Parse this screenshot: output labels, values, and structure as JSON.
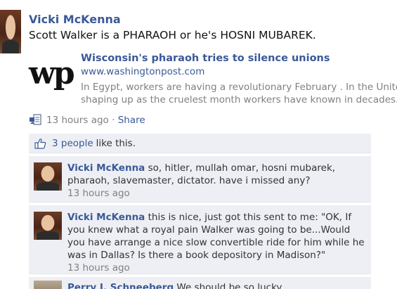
{
  "post": {
    "author": "Vicki McKenna",
    "status_text": "Scott Walker is a PHARAOH or he's HOSNI MUBAREK.",
    "link": {
      "logo_text": "wp",
      "title": "Wisconsin's pharaoh tries to silence unions",
      "url": "www.washingtonpost.com",
      "description_line1": "In Egypt, workers are having a revolutionary February . In the United S",
      "description_line2": "shaping up as the cruelest month workers have known in decades."
    },
    "timestamp": "13 hours ago",
    "separator": " · ",
    "share_label": "Share"
  },
  "likes": {
    "count": "3 people",
    "suffix": "like this."
  },
  "comments": [
    {
      "author": "Vicki McKenna",
      "text": "so, hitler, mullah omar, hosni mubarek, pharaoh, slavemaster, dictator. have i missed any?",
      "time": "13 hours ago"
    },
    {
      "author": "Vicki McKenna",
      "text": "this is nice, just got this sent to me: \"OK, If you knew what a royal pain Walker was going to be...Would you have arrange a nice slow convertible ride for him while he was in Dallas? Is there a book depository in Madison?\"",
      "time": "13 hours ago"
    },
    {
      "author": "Perry J. Schneeberg",
      "text": "We should be so lucky."
    }
  ],
  "colors": {
    "link_blue": "#3b5998",
    "comment_bg": "#edeff4",
    "meta_gray": "#808080"
  },
  "icons": {
    "share": "share-link-icon",
    "like": "thumbs-up-icon"
  }
}
